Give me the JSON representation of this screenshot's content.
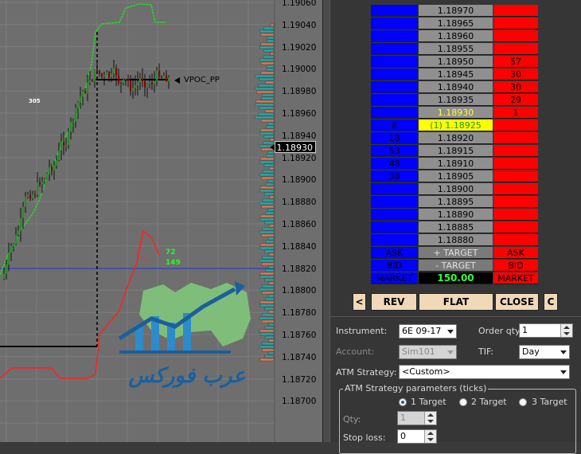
{
  "chart": {
    "y_ticks": [
      "1.19060",
      "1.19040",
      "1.19020",
      "1.19000",
      "1.18980",
      "1.18960",
      "1.18940",
      "1.18920",
      "1.18900",
      "1.18880",
      "1.18860",
      "1.18840",
      "1.18820",
      "1.18800",
      "1.18780",
      "1.18760",
      "1.18740",
      "1.18720",
      "1.18700"
    ],
    "current_price": "1.18930",
    "vpoc_label": "VPOC_PP",
    "label_305": "305",
    "label_72": "72",
    "label_149": "149",
    "up_color": "#2a8a2a",
    "down_color": "#8a0000",
    "green_line_color": "#22dd22",
    "red_line_color": "#ff2020"
  },
  "watermark": {
    "brand_text": "عرب فوركس"
  },
  "ladder": {
    "rows": [
      {
        "price": "1.18970",
        "left": "",
        "right": "",
        "highlight": ""
      },
      {
        "price": "1.18965",
        "left": "",
        "right": "",
        "highlight": ""
      },
      {
        "price": "1.18960",
        "left": "",
        "right": "",
        "highlight": ""
      },
      {
        "price": "1.18955",
        "left": "",
        "right": "",
        "highlight": ""
      },
      {
        "price": "1.18950",
        "left": "",
        "right": "57",
        "highlight": ""
      },
      {
        "price": "1.18945",
        "left": "",
        "right": "30",
        "highlight": ""
      },
      {
        "price": "1.18940",
        "left": "",
        "right": "30",
        "highlight": ""
      },
      {
        "price": "1.18935",
        "left": "",
        "right": "29",
        "highlight": ""
      },
      {
        "price": "1.18930",
        "left": "",
        "right": "1",
        "highlight": "last"
      },
      {
        "price": "(1) 1.18925",
        "left": "8",
        "right": "",
        "highlight": "position"
      },
      {
        "price": "1.18920",
        "left": "18",
        "right": "",
        "highlight": ""
      },
      {
        "price": "1.18915",
        "left": "53",
        "right": "",
        "highlight": ""
      },
      {
        "price": "1.18910",
        "left": "48",
        "right": "",
        "highlight": ""
      },
      {
        "price": "1.18905",
        "left": "38",
        "right": "",
        "highlight": ""
      },
      {
        "price": "1.18900",
        "left": "",
        "right": "",
        "highlight": ""
      },
      {
        "price": "1.18895",
        "left": "",
        "right": "",
        "highlight": ""
      },
      {
        "price": "1.18890",
        "left": "",
        "right": "",
        "highlight": ""
      },
      {
        "price": "1.18885",
        "left": "",
        "right": "",
        "highlight": ""
      },
      {
        "price": "1.18880",
        "left": "",
        "right": "",
        "highlight": ""
      }
    ],
    "ask_left": "ASK",
    "plus_target": "+ TARGET",
    "ask_right": "ASK",
    "bid_left": "BID",
    "minus_target": "- TARGET",
    "bid_right": "BID",
    "market_left": "MARKET",
    "market_qty": "150.00",
    "market_right": "MARKET"
  },
  "buttons": {
    "left_arrow": "<",
    "rev": "REV",
    "flat": "FLAT",
    "close": "CLOSE",
    "c": "C"
  },
  "order": {
    "instrument_label": "Instrument:",
    "instrument_value": "6E 09-17",
    "order_qty_label": "Order qty:",
    "order_qty_value": "1",
    "account_label": "Account:",
    "account_value": "Sim101",
    "tif_label": "TIF:",
    "tif_value": "Day",
    "atm_strategy_label": "ATM Strategy:",
    "atm_strategy_value": "<Custom>",
    "atm_params_label": "ATM Strategy parameters (ticks)",
    "target1": "1 Target",
    "target2": "2 Target",
    "target3": "3 Target",
    "qty_label": "Qty:",
    "qty_value": "1",
    "stop_loss_label": "Stop loss:",
    "stop_loss_value": "0"
  }
}
